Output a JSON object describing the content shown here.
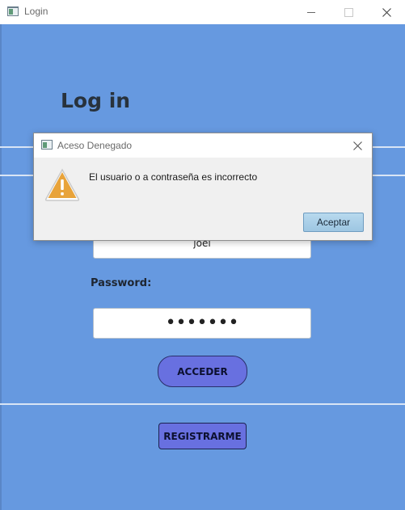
{
  "window": {
    "title": "Login",
    "icon": "app-window-icon"
  },
  "form": {
    "heading": "Log in",
    "username_value": "joel",
    "password_label": "Password:",
    "password_value": "•••••••",
    "login_button": "ACCEDER",
    "register_button": "REGISTRARME"
  },
  "dialog": {
    "title": "Aceso Denegado",
    "message": "El usuario o a contraseña es incorrecto",
    "icon": "warning-icon",
    "ok_button": "Aceptar"
  },
  "colors": {
    "background": "#6699e0",
    "button": "#6870e0",
    "warning": "#e8a33a"
  }
}
